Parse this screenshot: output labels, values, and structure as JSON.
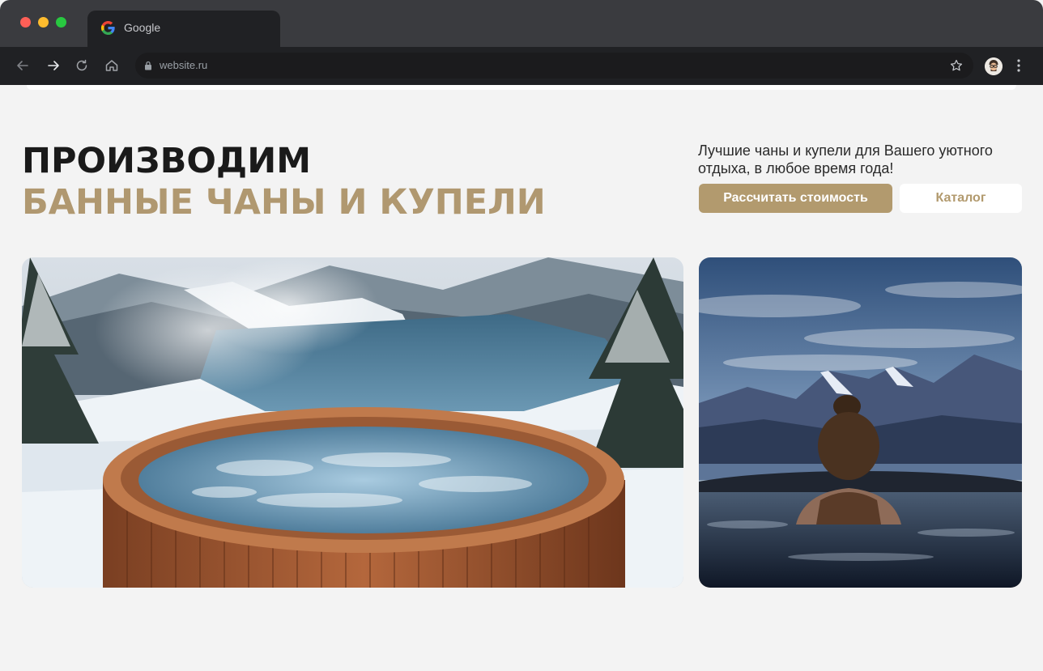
{
  "browser": {
    "tab_title": "Google",
    "url": "website.ru",
    "icons": {
      "tab": "google-icon",
      "back": "arrow-left-icon",
      "forward": "arrow-right-icon",
      "reload": "reload-icon",
      "home": "home-icon",
      "lock": "lock-icon",
      "bookmark": "star-icon",
      "profile": "avatar",
      "menu": "more-vertical-icon"
    }
  },
  "hero": {
    "headline_line1": "ПРОИЗВОДИМ",
    "headline_line2": "БАННЫЕ ЧАНЫ И КУПЕЛИ",
    "tagline": "Лучшие чаны и купели для Вашего уютного отдыха, в любое время года!",
    "primary_button": "Рассчитать стоимость",
    "secondary_button": "Каталог"
  },
  "colors": {
    "accent": "#b29a6e",
    "heading": "#1a1a1a",
    "page_bg": "#f3f3f3",
    "chrome_dark": "#202124"
  }
}
